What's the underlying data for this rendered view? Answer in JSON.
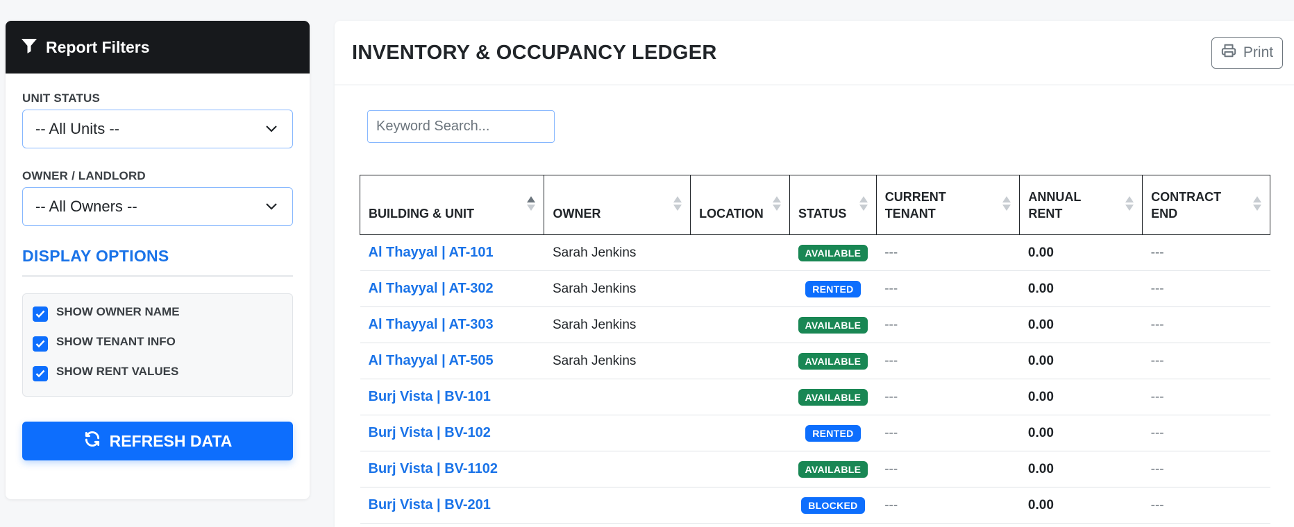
{
  "sidebar": {
    "title": "Report Filters",
    "unit_status": {
      "label": "UNIT STATUS",
      "value": "-- All Units --"
    },
    "owner": {
      "label": "OWNER / LANDLORD",
      "value": "-- All Owners --"
    },
    "display_options": {
      "title": "DISPLAY OPTIONS",
      "options": [
        {
          "label": "SHOW OWNER NAME",
          "checked": true
        },
        {
          "label": "SHOW TENANT INFO",
          "checked": true
        },
        {
          "label": "SHOW RENT VALUES",
          "checked": true
        }
      ]
    },
    "refresh_label": "REFRESH DATA"
  },
  "main": {
    "title": "INVENTORY & OCCUPANCY LEDGER",
    "print_label": "Print",
    "search_placeholder": "Keyword Search...",
    "columns": [
      "BUILDING & UNIT",
      "OWNER",
      "LOCATION",
      "STATUS",
      "CURRENT TENANT",
      "ANNUAL RENT",
      "CONTRACT END"
    ],
    "rows": [
      {
        "unit": "Al Thayyal | AT-101",
        "owner": "Sarah Jenkins",
        "location": "",
        "status": "AVAILABLE",
        "tenant": "---",
        "rent": "0.00",
        "end": "---"
      },
      {
        "unit": "Al Thayyal | AT-302",
        "owner": "Sarah Jenkins",
        "location": "",
        "status": "RENTED",
        "tenant": "---",
        "rent": "0.00",
        "end": "---"
      },
      {
        "unit": "Al Thayyal | AT-303",
        "owner": "Sarah Jenkins",
        "location": "",
        "status": "AVAILABLE",
        "tenant": "---",
        "rent": "0.00",
        "end": "---"
      },
      {
        "unit": "Al Thayyal | AT-505",
        "owner": "Sarah Jenkins",
        "location": "",
        "status": "AVAILABLE",
        "tenant": "---",
        "rent": "0.00",
        "end": "---"
      },
      {
        "unit": "Burj Vista | BV-101",
        "owner": "",
        "location": "",
        "status": "AVAILABLE",
        "tenant": "---",
        "rent": "0.00",
        "end": "---"
      },
      {
        "unit": "Burj Vista | BV-102",
        "owner": "",
        "location": "",
        "status": "RENTED",
        "tenant": "---",
        "rent": "0.00",
        "end": "---"
      },
      {
        "unit": "Burj Vista | BV-1102",
        "owner": "",
        "location": "",
        "status": "AVAILABLE",
        "tenant": "---",
        "rent": "0.00",
        "end": "---"
      },
      {
        "unit": "Burj Vista | BV-201",
        "owner": "",
        "location": "",
        "status": "BLOCKED",
        "tenant": "---",
        "rent": "0.00",
        "end": "---"
      }
    ]
  },
  "status_colors": {
    "AVAILABLE": "#198754",
    "RENTED": "#0d6efd",
    "BLOCKED": "#0d6efd"
  },
  "accent_color": "#1a73e8"
}
